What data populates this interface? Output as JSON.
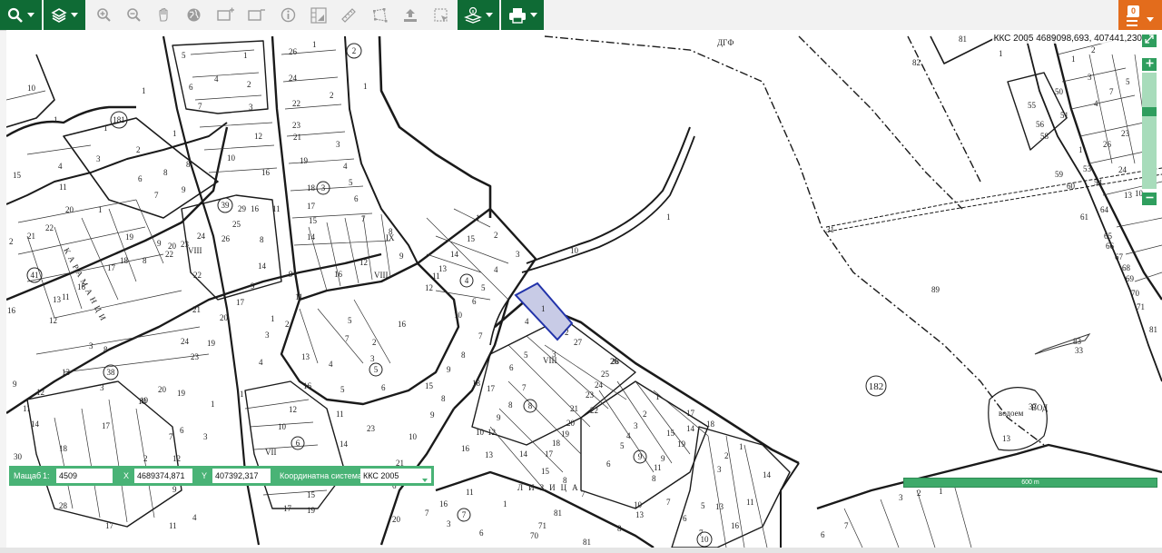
{
  "header": {
    "layer_count_badge": "0",
    "icons": [
      "search-icon",
      "layers-icon",
      "zoom-in-icon",
      "zoom-out-icon",
      "pan-hand-icon",
      "globe-icon",
      "add-rect-icon",
      "remove-rect-icon",
      "info-icon",
      "measure-grid-icon",
      "ruler-icon",
      "polygon-measure-icon",
      "upload-icon",
      "select-area-icon",
      "layer-info-icon",
      "print-icon",
      "menu-icon"
    ]
  },
  "colors": {
    "toolbar_green": "#0f6b35",
    "accent_orange": "#e36c1c",
    "status_green": "#49b376",
    "selected_parcel": "#2233aa"
  },
  "coordinate_readout": "ККС 2005 4689098,693, 407441,230",
  "status": {
    "scale_label": "Мащаб",
    "scale_prefix": "1:",
    "scale_value": "4509",
    "x_label": "X",
    "x_value": "4689374,871",
    "y_label": "Y",
    "y_value": "407392,317",
    "crs_label": "Координатна система",
    "crs_value": "ККС 2005"
  },
  "scale_bar": {
    "label": "600 m"
  },
  "map": {
    "circled_labels": [
      "181",
      "2",
      "39",
      "3",
      "41",
      "4",
      "38",
      "5",
      "6",
      "8",
      "9",
      "7",
      "10",
      "182"
    ],
    "area_labels": [
      "VIII",
      "IX",
      "VII",
      "ДГФ",
      "водоем",
      "ВОД"
    ],
    "road_labels": [
      "КАРАМАНЦИ",
      "ЛИЗИЦА"
    ],
    "parcel_numbers": [
      "10",
      "5",
      "1",
      "6",
      "2",
      "4",
      "7",
      "3",
      "13",
      "11",
      "12",
      "16",
      "8",
      "9",
      "14",
      "15",
      "17",
      "18",
      "19",
      "20",
      "21",
      "22",
      "23",
      "24",
      "25",
      "26",
      "27",
      "28",
      "29",
      "30",
      "31",
      "32",
      "33",
      "37",
      "47",
      "48",
      "50",
      "51",
      "53",
      "54",
      "55",
      "56",
      "58",
      "59",
      "60",
      "61",
      "64",
      "65",
      "66",
      "67",
      "68",
      "69",
      "70",
      "71",
      "81",
      "82",
      "83",
      "89"
    ]
  }
}
